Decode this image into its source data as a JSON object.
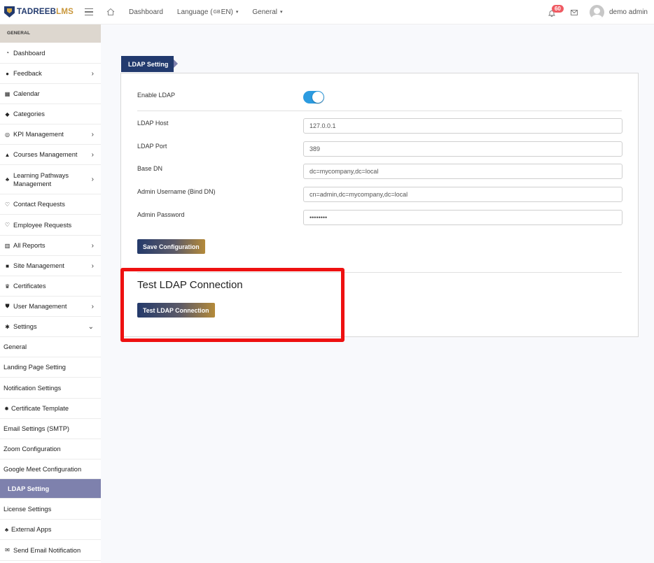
{
  "brand": {
    "name_part1": "TADREEB",
    "name_part2": "LMS"
  },
  "topbar": {
    "dashboard": "Dashboard",
    "language_label": "Language (",
    "language_code": "GB",
    "language_suffix": " EN)",
    "general": "General",
    "notification_count": "60",
    "username": "demo admin"
  },
  "sidebar": {
    "section": "GENERAL",
    "items": [
      {
        "label": "Dashboard"
      },
      {
        "label": "Feedback"
      },
      {
        "label": "Calendar"
      },
      {
        "label": "Categories"
      },
      {
        "label": "KPI Management"
      },
      {
        "label": "Courses Management"
      },
      {
        "label": "Learning Pathways Management"
      },
      {
        "label": "Contact Requests"
      },
      {
        "label": "Employee Requests"
      },
      {
        "label": "All Reports"
      },
      {
        "label": "Site Management"
      },
      {
        "label": "Certificates"
      },
      {
        "label": "User Management"
      },
      {
        "label": "Settings"
      },
      {
        "label": "General"
      },
      {
        "label": "Landing Page Setting"
      },
      {
        "label": "Notification Settings"
      },
      {
        "label": "Certificate Template"
      },
      {
        "label": "Email Settings (SMTP)"
      },
      {
        "label": "Zoom Configuration"
      },
      {
        "label": "Google Meet Configuration"
      },
      {
        "label": "LDAP Setting"
      },
      {
        "label": "License Settings"
      },
      {
        "label": "External Apps"
      },
      {
        "label": "Send Email Notification"
      }
    ]
  },
  "main": {
    "tab": "LDAP Setting",
    "enable_ldap_label": "Enable LDAP",
    "enable_ldap_on": true,
    "fields": {
      "host": {
        "label": "LDAP Host",
        "value": "127.0.0.1"
      },
      "port": {
        "label": "LDAP Port",
        "value": "389"
      },
      "base_dn": {
        "label": "Base DN",
        "value": "dc=mycompany,dc=local"
      },
      "bind_dn": {
        "label": "Admin Username (Bind DN)",
        "value": "cn=admin,dc=mycompany,dc=local"
      },
      "password": {
        "label": "Admin Password",
        "value": "••••••••"
      }
    },
    "save_button": "Save Configuration",
    "test_title": "Test LDAP Connection",
    "test_button": "Test LDAP Connection"
  },
  "colors": {
    "brand_navy": "#223a6e",
    "brand_gold": "#c9973b",
    "toggle_on": "#2c9be0",
    "active_sidebar": "#7e81ad",
    "highlight_red": "#ee1111"
  }
}
